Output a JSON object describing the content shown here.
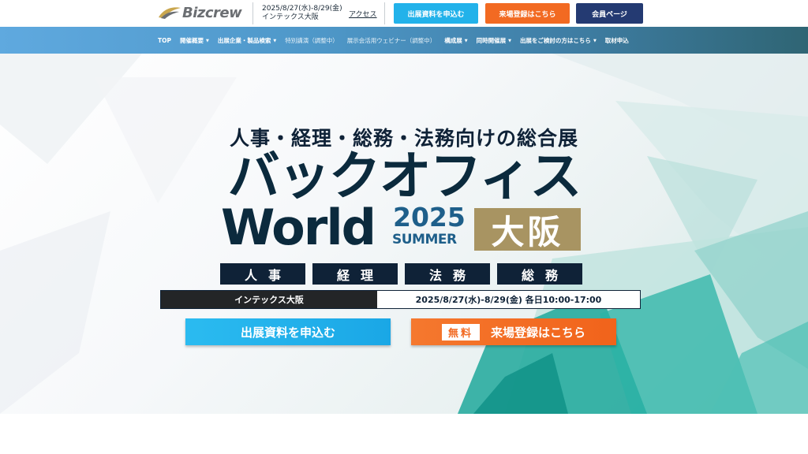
{
  "header": {
    "logo_text": "Bizcrew",
    "event_date": "2025/8/27(水)-8/29(金)",
    "event_venue": "インテックス大阪",
    "access_label": "アクセス",
    "buttons": {
      "exhibit_docs": "出展資料を申込む",
      "visitor_register": "来場登録はこちら",
      "member_page": "会員ページ"
    },
    "colors": {
      "blue": "#22b2ea",
      "orange": "#f26a22",
      "navy": "#243a72"
    }
  },
  "nav": {
    "items": [
      {
        "label": "TOP",
        "dropdown": false
      },
      {
        "label": "開催概要",
        "dropdown": true
      },
      {
        "label": "出展企業・製品検索",
        "dropdown": true
      },
      {
        "label": "特別講演（調整中）",
        "dropdown": false
      },
      {
        "label": "展示会活用ウェビナー（調整中）",
        "dropdown": false
      },
      {
        "label": "構成展",
        "dropdown": true
      },
      {
        "label": "同時開催展",
        "dropdown": true
      },
      {
        "label": "出展をご検討の方はこちら",
        "dropdown": true
      },
      {
        "label": "取材申込",
        "dropdown": false
      }
    ]
  },
  "hero": {
    "subtitle": "人事・経理・総務・法務向けの総合展",
    "title_jp": "バックオフィス",
    "title_world": "World",
    "year": "2025",
    "season": "SUMMER",
    "city": "大阪",
    "categories": [
      "人事",
      "経理",
      "法務",
      "総務"
    ],
    "venue": "インテックス大阪",
    "dates": "2025/8/27(水)-8/29(金) 各日10:00-17:00",
    "cta_exhibit": "出展資料を申込む",
    "cta_free_badge": "無料",
    "cta_register": "来場登録はこちら"
  }
}
